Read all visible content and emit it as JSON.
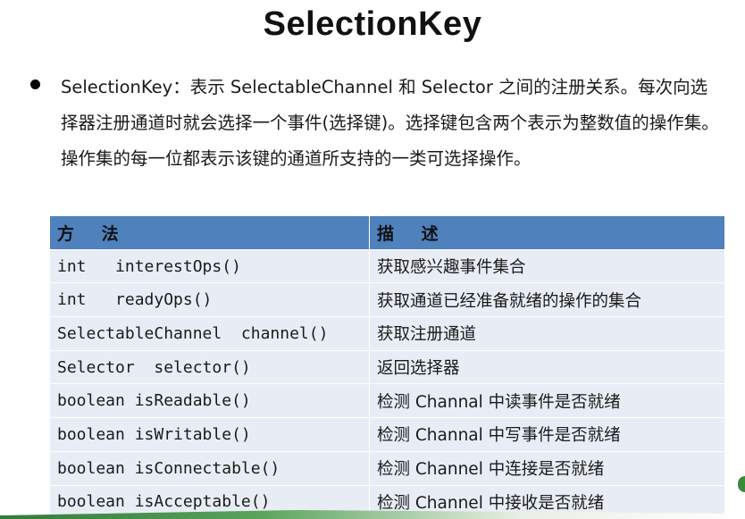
{
  "title": "SelectionKey",
  "bullet": {
    "text": "SelectionKey：表示 SelectableChannel 和 Selector 之间的注册关系。每次向选择器注册通道时就会选择一个事件(选择键)。选择键包含两个表示为整数值的操作集。操作集的每一位都表示该键的通道所支持的一类可选择操作。"
  },
  "table": {
    "headers": [
      "方 法",
      "描 述"
    ],
    "rows": [
      {
        "method": "int   interestOps()",
        "description": "获取感兴趣事件集合"
      },
      {
        "method": "int   readyOps()",
        "description": "获取通道已经准备就绪的操作的集合"
      },
      {
        "method": "SelectableChannel  channel()",
        "description": "获取注册通道"
      },
      {
        "method": "Selector  selector()",
        "description": "返回选择器"
      },
      {
        "method": "boolean isReadable()",
        "description": "检测 Channal 中读事件是否就绪"
      },
      {
        "method": "boolean isWritable()",
        "description": "检测 Channal 中写事件是否就绪"
      },
      {
        "method": "boolean isConnectable()",
        "description": "检测 Channel 中连接是否就绪"
      },
      {
        "method": "boolean isAcceptable()",
        "description": "检测 Channel 中接收是否就绪"
      }
    ]
  },
  "colors": {
    "header_bg": "#4f81bd",
    "row_bg": "#e8edf5",
    "footer_green": "#2f7d3a"
  }
}
